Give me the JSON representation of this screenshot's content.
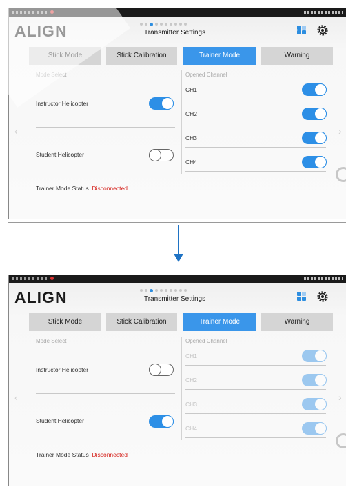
{
  "app": {
    "logo": "ALIGN",
    "title": "Transmitter Settings",
    "page_count": 10,
    "active_page_index": 2
  },
  "tabs": [
    "Stick Mode",
    "Stick Calibration",
    "Trainer Mode",
    "Warning"
  ],
  "active_tab": "Trainer Mode",
  "left_panel": {
    "section_label": "Mode Select",
    "instructor_label": "Instructor Helicopter",
    "student_label": "Student Helicopter",
    "status_label": "Trainer Mode Status",
    "status_value": "Disconnected"
  },
  "right_panel": {
    "section_label": "Opened Channel",
    "channels": [
      "CH1",
      "CH2",
      "CH3",
      "CH4"
    ]
  },
  "screens": [
    {
      "instructor_on": true,
      "student_on": false,
      "channels_enabled": true,
      "channels_on": [
        true,
        true,
        true,
        true
      ]
    },
    {
      "instructor_on": false,
      "student_on": true,
      "channels_enabled": false,
      "channels_on": [
        true,
        true,
        true,
        true
      ]
    }
  ],
  "colors": {
    "accent": "#3a96ea",
    "toggle_on": "#2d8fe6",
    "status_error": "#d6221c",
    "arrow": "#1f73c4"
  },
  "icons": {
    "apps": "grid-icon",
    "settings": "gear-icon",
    "prev": "chevron-left-icon",
    "next": "chevron-right-icon",
    "transition": "arrow-down-icon"
  }
}
